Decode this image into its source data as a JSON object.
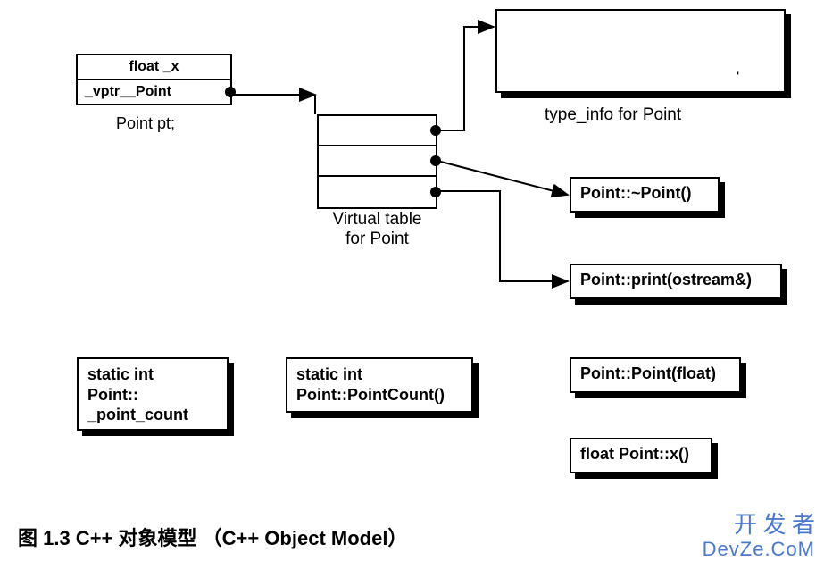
{
  "point_object": {
    "row1": "float _x",
    "row2": "_vptr__Point",
    "caption": "Point pt;"
  },
  "vtable": {
    "caption_line1": "Virtual table",
    "caption_line2": "for Point"
  },
  "typeinfo": {
    "caption": "type_info for Point"
  },
  "vtable_targets": {
    "dtor": "Point::~Point()",
    "print": "Point::print(ostream&)"
  },
  "bottom_boxes": {
    "static_count": "static int\nPoint::\n_point_count",
    "static_fn": "static int\nPoint::PointCount()",
    "ctor": "Point::Point(float)",
    "getx": "float Point::x()"
  },
  "figure_caption": "图 1.3    C++  对象模型 （C++ Object Model）",
  "watermark_line1": "开 发 者",
  "watermark_line2": "DevZe.CoM"
}
